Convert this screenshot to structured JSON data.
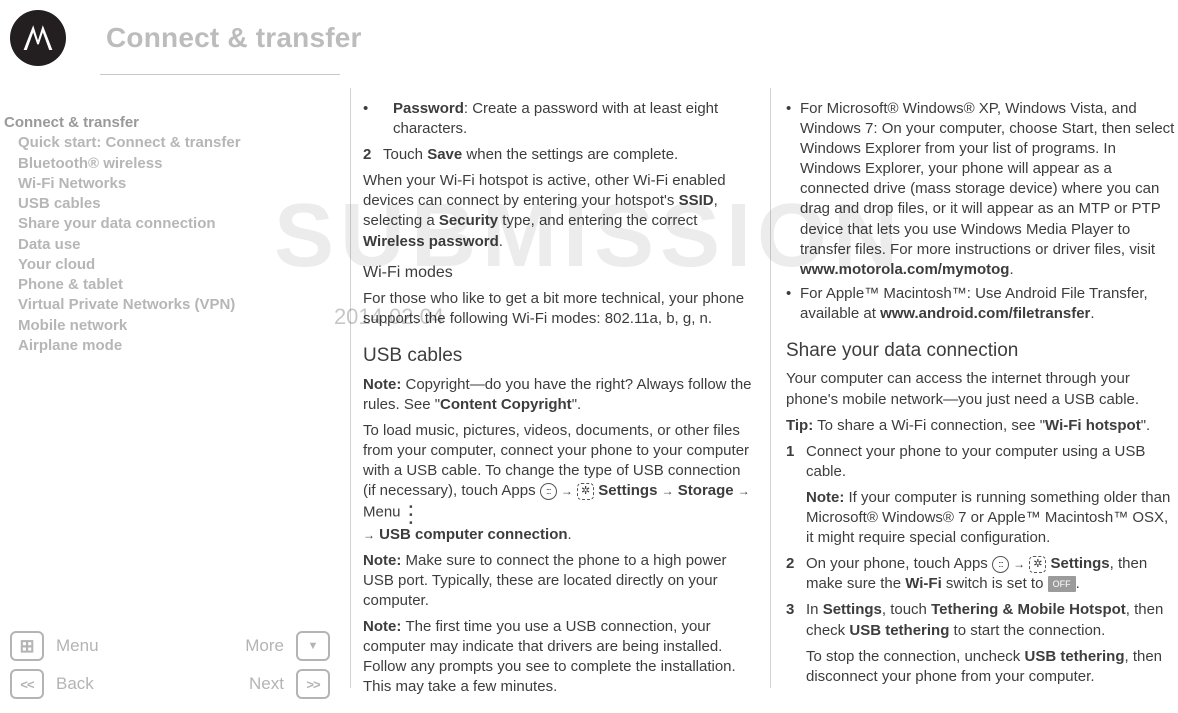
{
  "header": {
    "title": "Connect & transfer"
  },
  "nav": {
    "top": "Connect & transfer",
    "items": [
      "Quick start: Connect & transfer",
      "Bluetooth® wireless",
      "Wi-Fi Networks",
      "USB cables",
      "Share your data connection",
      "Data use",
      "Your cloud",
      "Phone & tablet",
      "Virtual Private Networks (VPN)",
      "Mobile network",
      "Airplane mode"
    ]
  },
  "footer": {
    "menu": "Menu",
    "more": "More",
    "back": "Back",
    "next": "Next"
  },
  "col1": {
    "b1a": "Password",
    "b1b": ": Create a password with at least eight characters.",
    "s2num": "2",
    "s2a": "Touch ",
    "s2b": "Save",
    "s2c": " when the settings are complete.",
    "p_hotspot_a": "When your Wi-Fi hotspot is active, other Wi-Fi enabled devices can connect by entering your hotspot's ",
    "p_hotspot_b": "SSID",
    "p_hotspot_c": ", selecting a ",
    "p_hotspot_d": "Security",
    "p_hotspot_e": " type, and entering the correct ",
    "p_hotspot_f": "Wireless password",
    "p_hotspot_g": ".",
    "h_modes": "Wi-Fi modes",
    "p_modes": "For those who like to get a bit more technical, your phone supports the following Wi-Fi modes: 802.11a, b, g, n.",
    "h_usb": "USB cables",
    "note1a": "Note: ",
    "note1b": "Copyright—do you have the right? Always follow the rules. See \"",
    "note1c": "Content Copyright",
    "note1d": "\".",
    "p_load_a": "To load music, pictures, videos, documents, or other files from your computer, connect your phone to your computer with a USB cable. To change the type of USB connection (if necessary), touch Apps ",
    "p_load_b": " Settings ",
    "p_load_c": " Storage ",
    "p_load_d": " Menu ",
    "p_load_e": " USB computer connection",
    "note2a": "Note: ",
    "note2b": "Make sure to connect the phone to a high power USB port. Typically, these are located directly on your computer.",
    "note3a": "Note: ",
    "note3b": "The first time you use a USB connection, your computer may indicate that drivers are being installed. Follow any prompts you see to complete the installation. This may take a few minutes."
  },
  "col2": {
    "b_win_a": "For Microsoft® Windows® XP, Windows Vista, and Windows 7: On your computer, choose Start, then select Windows Explorer from your list of programs. In Windows Explorer, your phone will appear as a connected drive (mass storage device) where you can drag and drop files, or it will appear as an MTP or PTP device that lets you use Windows Media Player to transfer files. For more instructions or driver files, visit ",
    "b_win_b": "www.motorola.com/mymotog",
    "b_win_c": ".",
    "b_mac_a": "For Apple™ Macintosh™: Use Android File Transfer, available at ",
    "b_mac_b": "www.android.com/filetransfer",
    "b_mac_c": ".",
    "h_share": "Share your data connection",
    "p_share": "Your computer can access the internet through your phone's mobile network—you just need a USB cable.",
    "tip_a": "Tip:",
    "tip_b": " To share a Wi-Fi connection, see \"",
    "tip_c": "Wi-Fi hotspot",
    "tip_d": "\".",
    "s1num": "1",
    "s1": "Connect your phone to your computer using a USB cable.",
    "s1note_a": "Note:",
    "s1note_b": " If your computer is running something older than Microsoft® Windows® 7 or Apple™ Macintosh™ OSX, it might require special configuration.",
    "s2num": "2",
    "s2a": "On your phone, touch Apps ",
    "s2b": " Settings",
    "s2c": ", then make sure the ",
    "s2d": "Wi-Fi",
    "s2e": " switch is set to ",
    "s2f": ".",
    "off_label": "OFF",
    "s3num": "3",
    "s3a": "In ",
    "s3b": "Settings",
    "s3c": ", touch ",
    "s3d": "Tethering & Mobile Hotspot",
    "s3e": ", then check ",
    "s3f": "USB tethering",
    "s3g": " to start the connection.",
    "s3stop_a": "To stop the connection, uncheck ",
    "s3stop_b": "USB tethering",
    "s3stop_c": ", then disconnect your phone from your computer."
  },
  "watermark": {
    "big": "SUBMISSION",
    "date": "2014.02.04"
  }
}
